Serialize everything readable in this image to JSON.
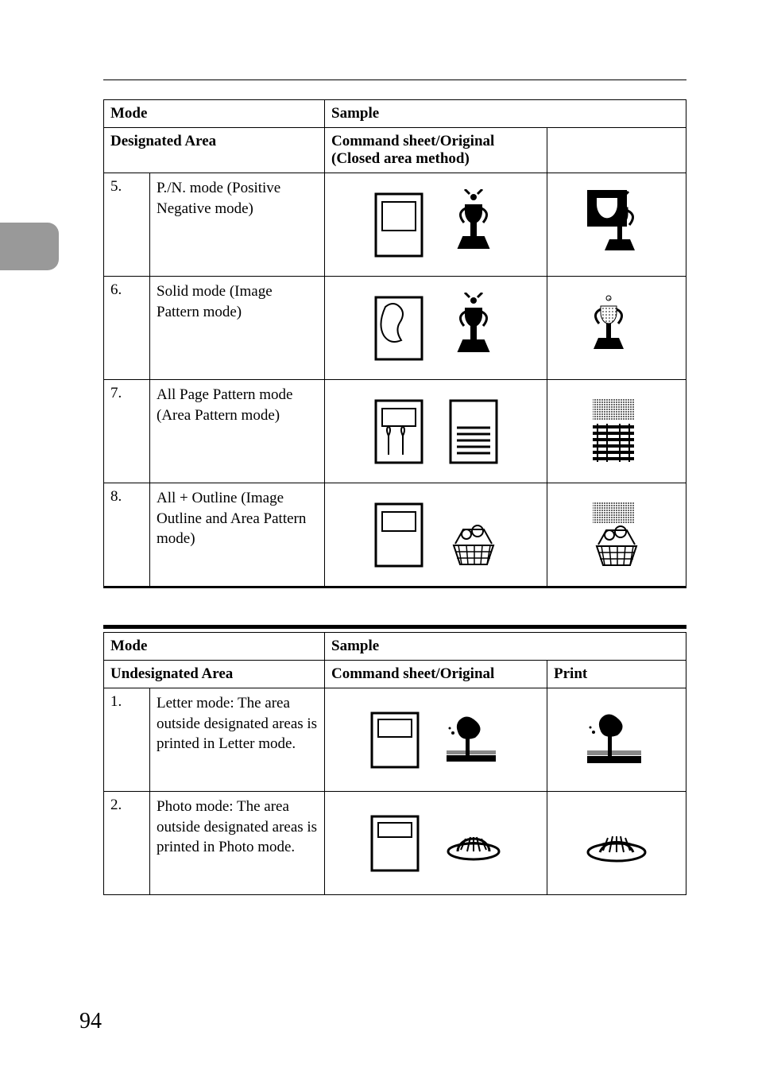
{
  "table1": {
    "header": {
      "mode": "Mode",
      "sample": "Sample",
      "area_label": "Designated Area",
      "sample_label": "Command sheet/Original\n(Closed area method)"
    },
    "rows": [
      {
        "num": "5.",
        "desc": "P./N. mode (Positive Negative mode)"
      },
      {
        "num": "6.",
        "desc": "Solid mode (Image Pattern mode)"
      },
      {
        "num": "7.",
        "desc": "All Page Pattern mode (Area Pattern mode)"
      },
      {
        "num": "8.",
        "desc": "All + Outline (Image Outline and Area Pattern mode)"
      }
    ]
  },
  "table2": {
    "header": {
      "mode": "Mode",
      "sample": "Sample",
      "area_label": "Undesignated Area",
      "sample_label": "Command sheet/Original",
      "print_label": "Print"
    },
    "rows": [
      {
        "num": "1.",
        "desc": "Letter mode: The area outside designated areas is printed in Letter mode."
      },
      {
        "num": "2.",
        "desc": "Photo mode: The area outside designated areas is printed in Photo mode."
      }
    ]
  },
  "page_number": "94"
}
